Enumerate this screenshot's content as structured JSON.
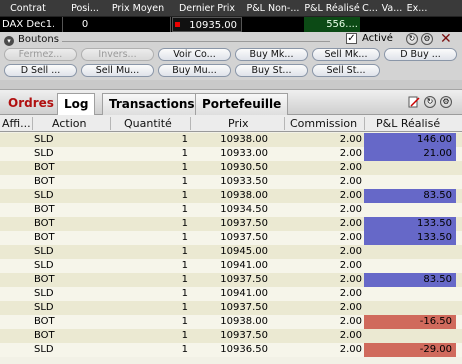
{
  "quote": {
    "headers": [
      "Contrat",
      "Posi...",
      "Prix Moyen",
      "Dernier Prix",
      "P&L Non-...",
      "P&L Réalisé",
      "C...",
      "Va...",
      "Ex..."
    ],
    "contract": "DAX Dec1...",
    "position": "0",
    "avg_price": "",
    "last_price": "10935.00",
    "unrealized": "",
    "realized": "556....",
    "c": "",
    "va": "",
    "ex": ""
  },
  "buttons_panel": {
    "title": "Boutons",
    "actif_label": "Activé",
    "buttons_row1": [
      {
        "label": "Fermez...",
        "disabled": true
      },
      {
        "label": "Invers...",
        "disabled": true
      },
      {
        "label": "Voir Co...",
        "disabled": false
      },
      {
        "label": "Buy Mk...",
        "disabled": false
      },
      {
        "label": "Sell Mk...",
        "disabled": false
      },
      {
        "label": "D Buy ...",
        "disabled": false
      }
    ],
    "buttons_row2": [
      {
        "label": "D Sell ...",
        "disabled": false
      },
      {
        "label": "Sell Mu...",
        "disabled": false
      },
      {
        "label": "Buy Mu...",
        "disabled": false
      },
      {
        "label": "Buy St...",
        "disabled": false
      },
      {
        "label": "Sell St...",
        "disabled": false
      }
    ]
  },
  "tabs": {
    "ordres": "Ordres",
    "log": "Log",
    "transactions": "Transactions",
    "portefeuille": "Portefeuille"
  },
  "table": {
    "headers": {
      "affi": "Affi...",
      "action": "Action",
      "quantite": "Quantité",
      "prix": "Prix",
      "commission": "Commission",
      "pl": "P&L Réalisé"
    },
    "rows": [
      {
        "action": "SLD",
        "qty": "1",
        "price": "10938.00",
        "comm": "2.00",
        "pl": "146.00"
      },
      {
        "action": "SLD",
        "qty": "1",
        "price": "10933.00",
        "comm": "2.00",
        "pl": "21.00"
      },
      {
        "action": "BOT",
        "qty": "1",
        "price": "10930.50",
        "comm": "2.00",
        "pl": ""
      },
      {
        "action": "BOT",
        "qty": "1",
        "price": "10933.50",
        "comm": "2.00",
        "pl": ""
      },
      {
        "action": "SLD",
        "qty": "1",
        "price": "10938.00",
        "comm": "2.00",
        "pl": "83.50"
      },
      {
        "action": "BOT",
        "qty": "1",
        "price": "10934.50",
        "comm": "2.00",
        "pl": ""
      },
      {
        "action": "BOT",
        "qty": "1",
        "price": "10937.50",
        "comm": "2.00",
        "pl": "133.50"
      },
      {
        "action": "BOT",
        "qty": "1",
        "price": "10937.50",
        "comm": "2.00",
        "pl": "133.50"
      },
      {
        "action": "SLD",
        "qty": "1",
        "price": "10945.00",
        "comm": "2.00",
        "pl": ""
      },
      {
        "action": "SLD",
        "qty": "1",
        "price": "10941.00",
        "comm": "2.00",
        "pl": ""
      },
      {
        "action": "BOT",
        "qty": "1",
        "price": "10937.50",
        "comm": "2.00",
        "pl": "83.50"
      },
      {
        "action": "SLD",
        "qty": "1",
        "price": "10941.00",
        "comm": "2.00",
        "pl": ""
      },
      {
        "action": "SLD",
        "qty": "1",
        "price": "10937.50",
        "comm": "2.00",
        "pl": ""
      },
      {
        "action": "BOT",
        "qty": "1",
        "price": "10938.00",
        "comm": "2.00",
        "pl": "-16.50"
      },
      {
        "action": "BOT",
        "qty": "1",
        "price": "10937.50",
        "comm": "2.00",
        "pl": ""
      },
      {
        "action": "SLD",
        "qty": "1",
        "price": "10936.50",
        "comm": "2.00",
        "pl": "-29.00"
      }
    ]
  },
  "colors": {
    "pl_positive": "#6668c8",
    "pl_negative": "#d06a5c",
    "realized_bg": "#0c4a15"
  }
}
